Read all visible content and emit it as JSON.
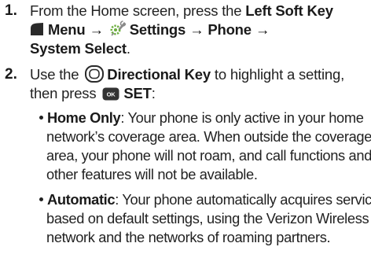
{
  "step1": {
    "number": "1.",
    "line1_prefix": "From the Home screen, press the ",
    "left_soft_key": "Left Soft Key",
    "menu_label": "Menu",
    "arrow1": "→",
    "settings_label": "Settings",
    "arrow2": "→",
    "phone_label": "Phone",
    "arrow3": "→",
    "system_select_label": "System Select",
    "period": "."
  },
  "step2": {
    "number": "2.",
    "use_text": "Use the ",
    "directional_key": "Directional Key",
    "highlight_text": " to highlight a setting,",
    "then_press": "then press ",
    "ok_key_text": "OK",
    "set_label": "SET",
    "colon": ":"
  },
  "bullets": [
    {
      "term": "Home Only",
      "lines": [
        ": Your phone is only active in your home",
        "network’s coverage area. When outside the coverage",
        "area, your phone will not roam, and call functions and",
        "other features will not be available."
      ]
    },
    {
      "term": "Automatic",
      "lines": [
        ": Your phone automatically acquires service",
        "based on default settings, using the Verizon Wireless",
        "network and the networks of roaming partners."
      ]
    }
  ],
  "icons": {
    "left_soft_key": "left-soft-key-icon",
    "settings": "settings-icon",
    "directional_key": "directional-key-icon",
    "ok_key": "ok-key-icon"
  },
  "colors": {
    "text": "#222222",
    "ok_key_bg": "#333333",
    "settings_icon": "#6cae3e"
  }
}
